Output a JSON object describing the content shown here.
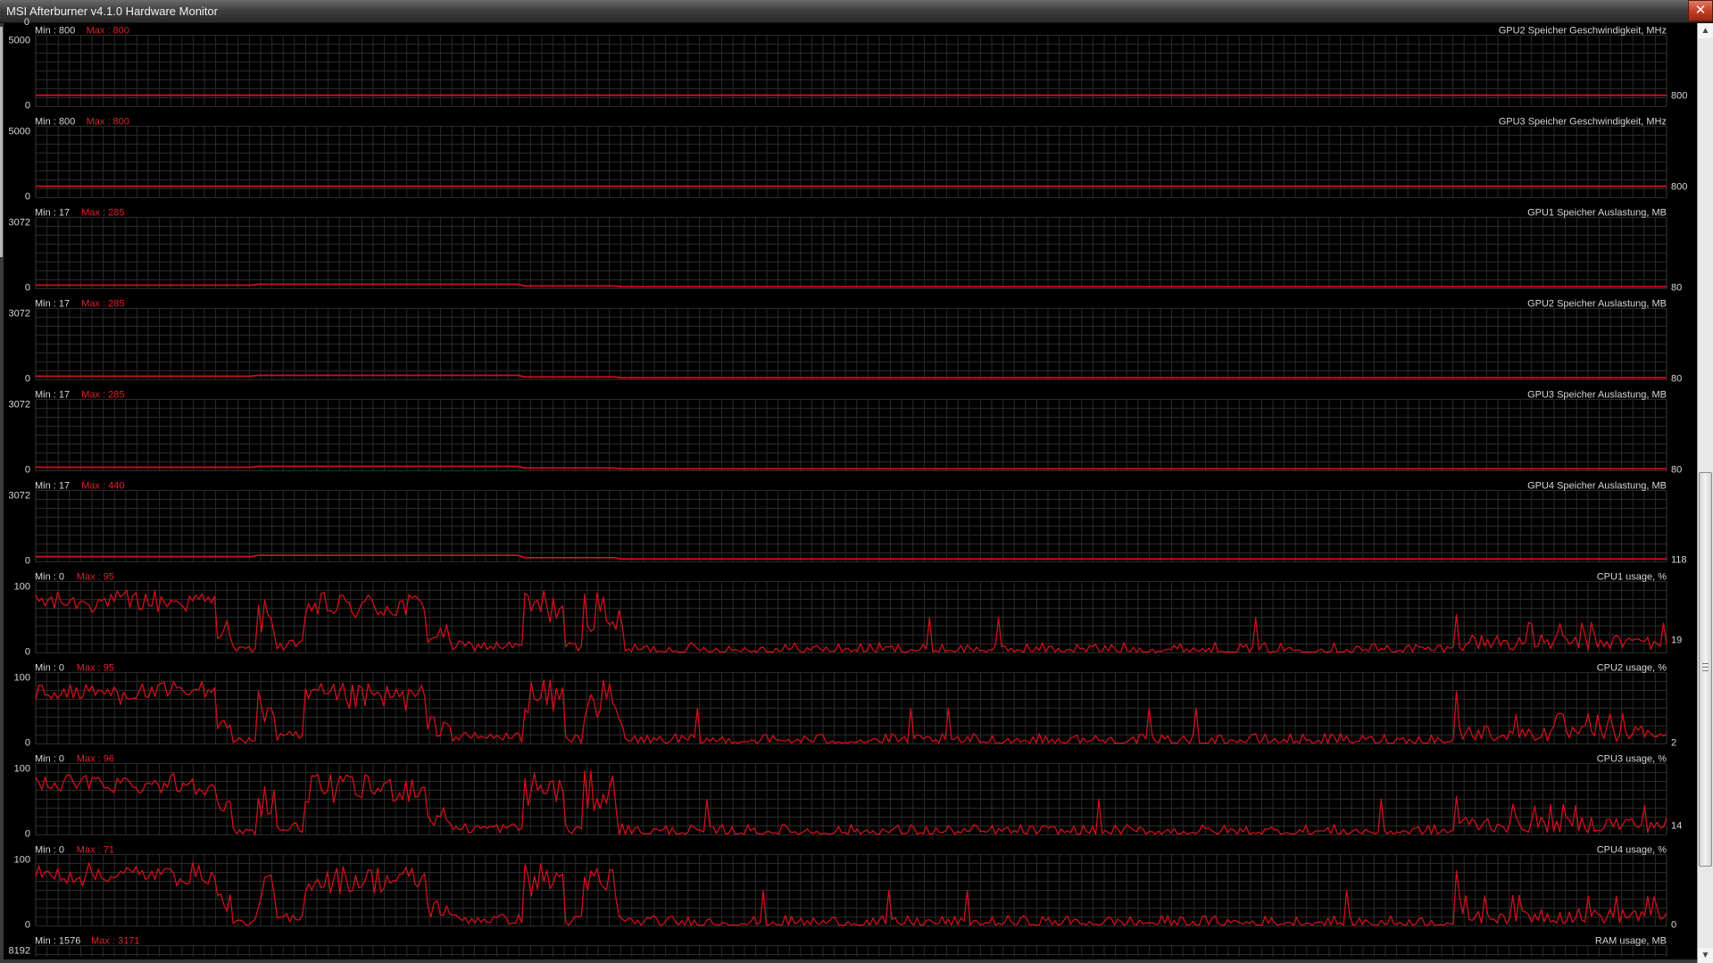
{
  "window": {
    "title": "MSI Afterburner v4.1.0 Hardware Monitor",
    "close_glyph": "✕"
  },
  "scrollbar": {
    "up_glyph": "▲",
    "down_glyph": "▼"
  },
  "colors": {
    "background": "#000000",
    "grid": "#2b2b2b",
    "grid_major": "#3a3a3a",
    "trace": "#d0101c",
    "max_text": "#e0202a",
    "label_text": "#d6d6d6"
  },
  "top_partial_tick": "0",
  "chart_data": [
    {
      "type": "line",
      "title": "GPU2 Speicher Geschwindigkeit, MHz",
      "ylim": [
        0,
        5000
      ],
      "y_top_label": "5000",
      "y_bottom_label": "0",
      "min_label": "Min : 800",
      "max_label": "Max : 800",
      "current_value": "800",
      "profile": "flat",
      "level": 800
    },
    {
      "type": "line",
      "title": "GPU3 Speicher Geschwindigkeit, MHz",
      "ylim": [
        0,
        5000
      ],
      "y_top_label": "5000",
      "y_bottom_label": "0",
      "min_label": "Min : 800",
      "max_label": "Max : 800",
      "current_value": "800",
      "profile": "flat",
      "level": 800
    },
    {
      "type": "line",
      "title": "GPU1 Speicher Auslastung, MB",
      "ylim": [
        0,
        3072
      ],
      "y_top_label": "3072",
      "y_bottom_label": "0",
      "min_label": "Min : 17",
      "max_label": "Max : 285",
      "current_value": "80",
      "profile": "memory",
      "level": 80
    },
    {
      "type": "line",
      "title": "GPU2 Speicher Auslastung, MB",
      "ylim": [
        0,
        3072
      ],
      "y_top_label": "3072",
      "y_bottom_label": "0",
      "min_label": "Min : 17",
      "max_label": "Max : 285",
      "current_value": "80",
      "profile": "memory",
      "level": 80
    },
    {
      "type": "line",
      "title": "GPU3 Speicher Auslastung, MB",
      "ylim": [
        0,
        3072
      ],
      "y_top_label": "3072",
      "y_bottom_label": "0",
      "min_label": "Min : 17",
      "max_label": "Max : 285",
      "current_value": "80",
      "profile": "memory",
      "level": 80
    },
    {
      "type": "line",
      "title": "GPU4 Speicher Auslastung, MB",
      "ylim": [
        0,
        3072
      ],
      "y_top_label": "3072",
      "y_bottom_label": "0",
      "min_label": "Min : 17",
      "max_label": "Max : 440",
      "current_value": "118",
      "profile": "memory",
      "level": 118
    },
    {
      "type": "line",
      "title": "CPU1 usage, %",
      "ylim": [
        0,
        100
      ],
      "y_top_label": "100",
      "y_bottom_label": "0",
      "min_label": "Min : 0",
      "max_label": "Max : 95",
      "current_value": "19",
      "profile": "cpu",
      "level": 19
    },
    {
      "type": "line",
      "title": "CPU2 usage, %",
      "ylim": [
        0,
        100
      ],
      "y_top_label": "100",
      "y_bottom_label": "0",
      "min_label": "Min : 0",
      "max_label": "Max : 95",
      "current_value": "2",
      "profile": "cpu",
      "level": 2
    },
    {
      "type": "line",
      "title": "CPU3 usage, %",
      "ylim": [
        0,
        100
      ],
      "y_top_label": "100",
      "y_bottom_label": "0",
      "min_label": "Min : 0",
      "max_label": "Max : 96",
      "current_value": "14",
      "profile": "cpu",
      "level": 14
    },
    {
      "type": "line",
      "title": "CPU4 usage, %",
      "ylim": [
        0,
        100
      ],
      "y_top_label": "100",
      "y_bottom_label": "0",
      "min_label": "Min : 0",
      "max_label": "Max : 71",
      "current_value": "0",
      "profile": "cpu",
      "level": 0
    },
    {
      "type": "line",
      "title": "RAM usage, MB",
      "y_top_label": "8192",
      "min_label": "Min : 1576",
      "max_label": "Max : 3171",
      "profile": "partial"
    }
  ]
}
